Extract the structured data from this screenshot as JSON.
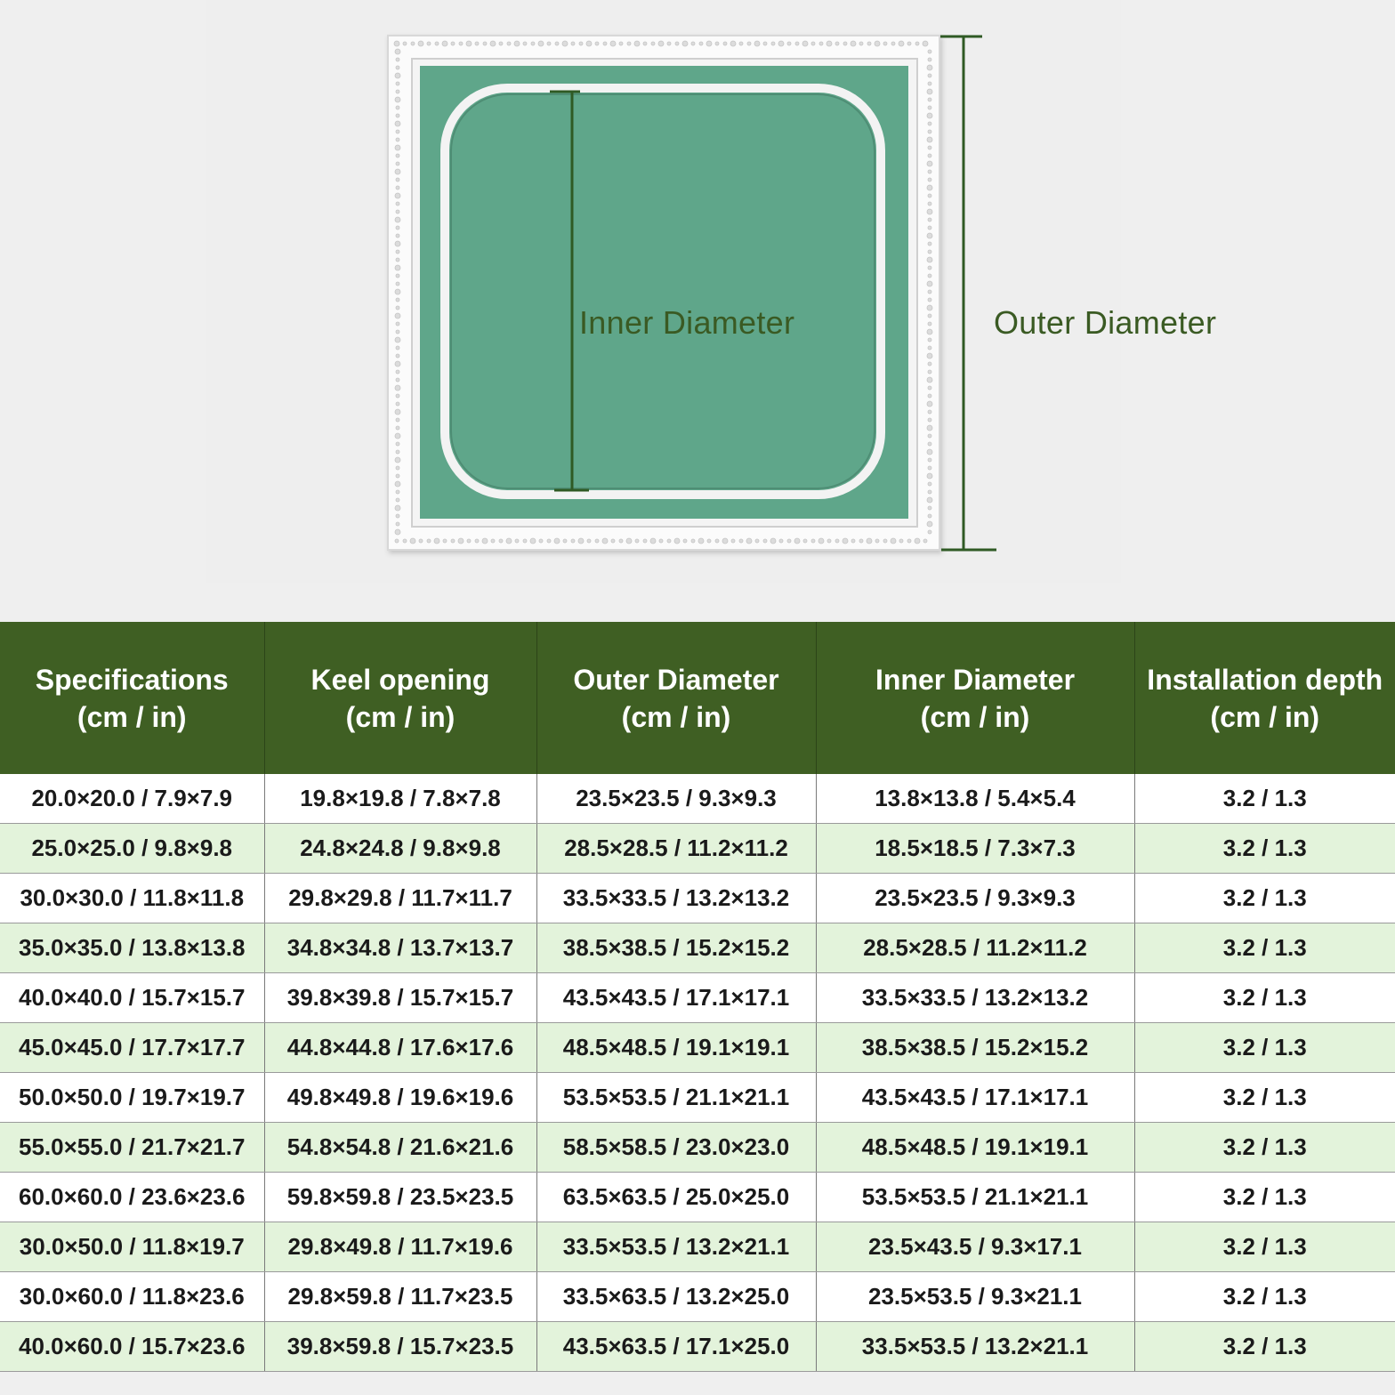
{
  "diagram": {
    "inner_label": "Inner Diameter",
    "outer_label": "Outer Diameter",
    "colors": {
      "panel_green": "#5fa68a",
      "frame_white": "#fbfbfb",
      "dimension_line": "#2f5a24",
      "label_text": "#3a5a23"
    }
  },
  "table": {
    "header_color": "#3f5f23",
    "stripe_color": "#e3f3db",
    "headers": [
      {
        "line1": "Specifications",
        "line2": "(cm / in)"
      },
      {
        "line1": "Keel opening",
        "line2": "(cm / in)"
      },
      {
        "line1": "Outer Diameter",
        "line2": "(cm / in)"
      },
      {
        "line1": "Inner Diameter",
        "line2": "(cm / in)"
      },
      {
        "line1": "Installation depth",
        "line2": "(cm / in)"
      }
    ],
    "rows": [
      [
        "20.0×20.0 / 7.9×7.9",
        "19.8×19.8 / 7.8×7.8",
        "23.5×23.5 / 9.3×9.3",
        "13.8×13.8 / 5.4×5.4",
        "3.2 / 1.3"
      ],
      [
        "25.0×25.0 / 9.8×9.8",
        "24.8×24.8 / 9.8×9.8",
        "28.5×28.5 / 11.2×11.2",
        "18.5×18.5 / 7.3×7.3",
        "3.2 / 1.3"
      ],
      [
        "30.0×30.0 / 11.8×11.8",
        "29.8×29.8 / 11.7×11.7",
        "33.5×33.5 / 13.2×13.2",
        "23.5×23.5 / 9.3×9.3",
        "3.2 / 1.3"
      ],
      [
        "35.0×35.0 / 13.8×13.8",
        "34.8×34.8 / 13.7×13.7",
        "38.5×38.5 / 15.2×15.2",
        "28.5×28.5 / 11.2×11.2",
        "3.2 / 1.3"
      ],
      [
        "40.0×40.0 / 15.7×15.7",
        "39.8×39.8 / 15.7×15.7",
        "43.5×43.5 / 17.1×17.1",
        "33.5×33.5 / 13.2×13.2",
        "3.2 / 1.3"
      ],
      [
        "45.0×45.0 / 17.7×17.7",
        "44.8×44.8 / 17.6×17.6",
        "48.5×48.5 / 19.1×19.1",
        "38.5×38.5 / 15.2×15.2",
        "3.2 / 1.3"
      ],
      [
        "50.0×50.0 / 19.7×19.7",
        "49.8×49.8 / 19.6×19.6",
        "53.5×53.5 / 21.1×21.1",
        "43.5×43.5 / 17.1×17.1",
        "3.2 / 1.3"
      ],
      [
        "55.0×55.0 / 21.7×21.7",
        "54.8×54.8 / 21.6×21.6",
        "58.5×58.5 / 23.0×23.0",
        "48.5×48.5 / 19.1×19.1",
        "3.2 / 1.3"
      ],
      [
        "60.0×60.0 / 23.6×23.6",
        "59.8×59.8 / 23.5×23.5",
        "63.5×63.5 / 25.0×25.0",
        "53.5×53.5 / 21.1×21.1",
        "3.2 / 1.3"
      ],
      [
        "30.0×50.0 / 11.8×19.7",
        "29.8×49.8 / 11.7×19.6",
        "33.5×53.5 / 13.2×21.1",
        "23.5×43.5 / 9.3×17.1",
        "3.2 / 1.3"
      ],
      [
        "30.0×60.0 / 11.8×23.6",
        "29.8×59.8 / 11.7×23.5",
        "33.5×63.5 / 13.2×25.0",
        "23.5×53.5 / 9.3×21.1",
        "3.2 / 1.3"
      ],
      [
        "40.0×60.0 / 15.7×23.6",
        "39.8×59.8 / 15.7×23.5",
        "43.5×63.5 / 17.1×25.0",
        "33.5×53.5 / 13.2×21.1",
        "3.2 / 1.3"
      ]
    ]
  }
}
